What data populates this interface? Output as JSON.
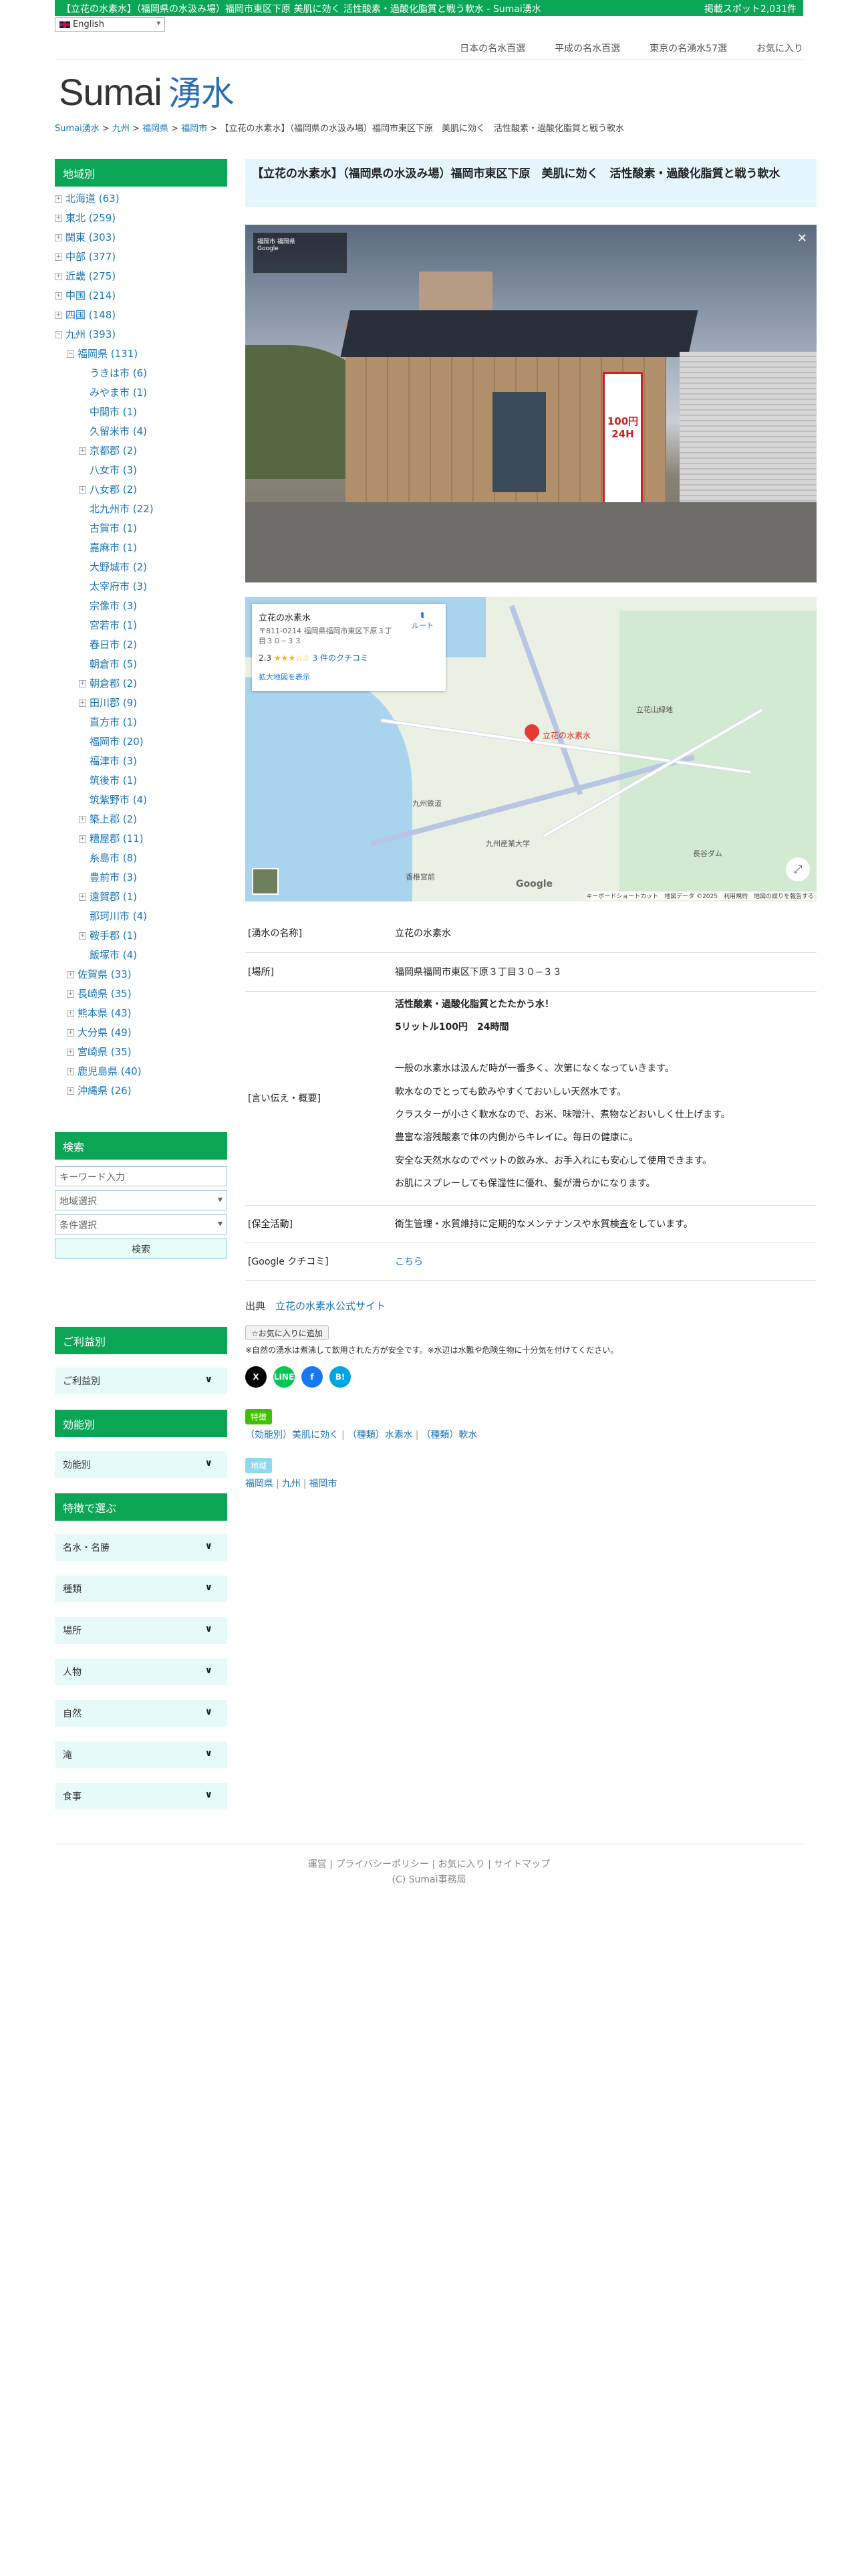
{
  "topbar": {
    "title": "【立花の水素水】（福岡県の水汲み場）福岡市東区下原 美肌に効く 活性酸素・過酸化脂質と戦う軟水 - Sumai湧水",
    "count": "掲載スポット2,031件"
  },
  "language": "English",
  "nav": [
    "日本の名水百選",
    "平成の名水百選",
    "東京の名湧水57選",
    "お気に入り"
  ],
  "logo": {
    "text": "Sumai",
    "accent": "湧水"
  },
  "breadcrumb": {
    "items": [
      "Sumai湧水",
      "九州",
      "福岡県",
      "福岡市"
    ],
    "current": "【立花の水素水】（福岡県の水汲み場）福岡市東区下原　美肌に効く　活性酸素・過酸化脂質と戦う軟水"
  },
  "sidebar": {
    "region_heading": "地域別",
    "tree": [
      {
        "label": "北海道 (63)",
        "level": 0,
        "toggle": "+"
      },
      {
        "label": "東北 (259)",
        "level": 0,
        "toggle": "+"
      },
      {
        "label": "関東 (303)",
        "level": 0,
        "toggle": "+"
      },
      {
        "label": "中部 (377)",
        "level": 0,
        "toggle": "+"
      },
      {
        "label": "近畿 (275)",
        "level": 0,
        "toggle": "+"
      },
      {
        "label": "中国 (214)",
        "level": 0,
        "toggle": "+"
      },
      {
        "label": "四国 (148)",
        "level": 0,
        "toggle": "+"
      },
      {
        "label": "九州 (393)",
        "level": 0,
        "toggle": "−"
      },
      {
        "label": "福岡県 (131)",
        "level": 1,
        "toggle": "−"
      },
      {
        "label": "うきは市 (6)",
        "level": 2,
        "toggle": ""
      },
      {
        "label": "みやま市 (1)",
        "level": 2,
        "toggle": ""
      },
      {
        "label": "中間市 (1)",
        "level": 2,
        "toggle": ""
      },
      {
        "label": "久留米市 (4)",
        "level": 2,
        "toggle": ""
      },
      {
        "label": "京都郡 (2)",
        "level": 2,
        "toggle": "+"
      },
      {
        "label": "八女市 (3)",
        "level": 2,
        "toggle": ""
      },
      {
        "label": "八女郡 (2)",
        "level": 2,
        "toggle": "+"
      },
      {
        "label": "北九州市 (22)",
        "level": 2,
        "toggle": ""
      },
      {
        "label": "古賀市 (1)",
        "level": 2,
        "toggle": ""
      },
      {
        "label": "嘉麻市 (1)",
        "level": 2,
        "toggle": ""
      },
      {
        "label": "大野城市 (2)",
        "level": 2,
        "toggle": ""
      },
      {
        "label": "太宰府市 (3)",
        "level": 2,
        "toggle": ""
      },
      {
        "label": "宗像市 (3)",
        "level": 2,
        "toggle": ""
      },
      {
        "label": "宮若市 (1)",
        "level": 2,
        "toggle": ""
      },
      {
        "label": "春日市 (2)",
        "level": 2,
        "toggle": ""
      },
      {
        "label": "朝倉市 (5)",
        "level": 2,
        "toggle": ""
      },
      {
        "label": "朝倉郡 (2)",
        "level": 2,
        "toggle": "+"
      },
      {
        "label": "田川郡 (9)",
        "level": 2,
        "toggle": "+"
      },
      {
        "label": "直方市 (1)",
        "level": 2,
        "toggle": ""
      },
      {
        "label": "福岡市 (20)",
        "level": 2,
        "toggle": ""
      },
      {
        "label": "福津市 (3)",
        "level": 2,
        "toggle": ""
      },
      {
        "label": "筑後市 (1)",
        "level": 2,
        "toggle": ""
      },
      {
        "label": "筑紫野市 (4)",
        "level": 2,
        "toggle": ""
      },
      {
        "label": "築上郡 (2)",
        "level": 2,
        "toggle": "+"
      },
      {
        "label": "糟屋郡 (11)",
        "level": 2,
        "toggle": "+"
      },
      {
        "label": "糸島市 (8)",
        "level": 2,
        "toggle": ""
      },
      {
        "label": "豊前市 (3)",
        "level": 2,
        "toggle": ""
      },
      {
        "label": "遠賀郡 (1)",
        "level": 2,
        "toggle": "+"
      },
      {
        "label": "那珂川市 (4)",
        "level": 2,
        "toggle": ""
      },
      {
        "label": "鞍手郡 (1)",
        "level": 2,
        "toggle": "+"
      },
      {
        "label": "飯塚市 (4)",
        "level": 2,
        "toggle": ""
      },
      {
        "label": "佐賀県 (33)",
        "level": 1,
        "toggle": "+"
      },
      {
        "label": "長崎県 (35)",
        "level": 1,
        "toggle": "+"
      },
      {
        "label": "熊本県 (43)",
        "level": 1,
        "toggle": "+"
      },
      {
        "label": "大分県 (49)",
        "level": 1,
        "toggle": "+"
      },
      {
        "label": "宮崎県 (35)",
        "level": 1,
        "toggle": "+"
      },
      {
        "label": "鹿児島県 (40)",
        "level": 1,
        "toggle": "+"
      },
      {
        "label": "沖縄県 (26)",
        "level": 1,
        "toggle": "+"
      }
    ],
    "search": {
      "heading": "検索",
      "keyword_placeholder": "キーワード入力",
      "region_select": "地域選択",
      "condition_select": "条件選択",
      "button": "検索"
    },
    "benefit_heading": "ご利益別",
    "benefit_item": "ご利益別",
    "effect_heading": "効能別",
    "effect_item": "効能別",
    "feature_heading": "特徴で選ぶ",
    "features": [
      "名水・名勝",
      "種類",
      "場所",
      "人物",
      "自然",
      "滝",
      "食事"
    ]
  },
  "main": {
    "title": "【立花の水素水】（福岡県の水汲み場）福岡市東区下原　美肌に効く　活性酸素・過酸化脂質と戦う軟水",
    "photo": {
      "banner": "100円 24H",
      "overlay_line1": "福岡市 福岡県",
      "overlay_line2": "Google"
    },
    "map": {
      "place_name": "立花の水素水",
      "address": "〒811-0214 福岡県福岡市東区下原３丁目３０−３３",
      "route": "ルート",
      "rating": "2.3",
      "stars": "★★★☆☆",
      "reviews": "3 件のクチコミ",
      "bigger_map": "拡大地図を表示",
      "pin_label": "立花の水素水",
      "labels": [
        "立花山緑地",
        "九州産業大学",
        "長谷ダム",
        "香椎宮前",
        "九州鉄道"
      ],
      "brand": "Google",
      "footer": "キーボードショートカット　地図データ ©2025　利用規約　地図の誤りを報告する"
    },
    "table": {
      "name_key": "[湧水の名称]",
      "name_val": "立花の水素水",
      "place_key": "[場所]",
      "place_val": "福岡県福岡市東区下原３丁目３０−３３",
      "legend_key": "[言い伝え・概要]",
      "legend_lines": [
        "活性酸素・過酸化脂質とたたかう水！",
        "5リットル100円　24時間",
        "",
        "一般の水素水は汲んだ時が一番多く、次第になくなっていきます。",
        "軟水なのでとっても飲みやすくておいしい天然水です。",
        "クラスターが小さく軟水なので、お米、味噌汁、煮物などおいしく仕上げます。",
        "豊富な溶残酸素で体の内側からキレイに。毎日の健康に。",
        "安全な天然水なのでペットの飲み水、お手入れにも安心して使用できます。",
        "お肌にスプレーしても保湿性に優れ、髪が滑らかになります。"
      ],
      "maint_key": "[保全活動]",
      "maint_val": "衛生管理・水質維持に定期的なメンテナンスや水質検査をしています。",
      "google_key": "[Google クチコミ]",
      "google_val": "こちら"
    },
    "source_label": "出典",
    "source_link": "立花の水素水公式サイト",
    "fav_button": "☆お気に入りに追加",
    "note": "※自然の湧水は煮沸して飲用された方が安全です。※水辺は水難や危険生物に十分気を付けてください。",
    "shares": [
      "X",
      "LINE",
      "f",
      "B!"
    ],
    "share_colors": [
      "#000000",
      "#06c755",
      "#1877f2",
      "#00a4de"
    ],
    "tag_feature_label": "特徴",
    "tag_features": [
      "（効能別）美肌に効く",
      "（種類）水素水",
      "（種類）軟水"
    ],
    "tag_area_label": "地域",
    "tag_areas": [
      "福岡県",
      "九州",
      "福岡市"
    ]
  },
  "footer": {
    "links": [
      "運営",
      "プライバシーポリシー",
      "お気に入り",
      "サイトマップ"
    ],
    "copyright": "(C) Sumai事務局"
  }
}
